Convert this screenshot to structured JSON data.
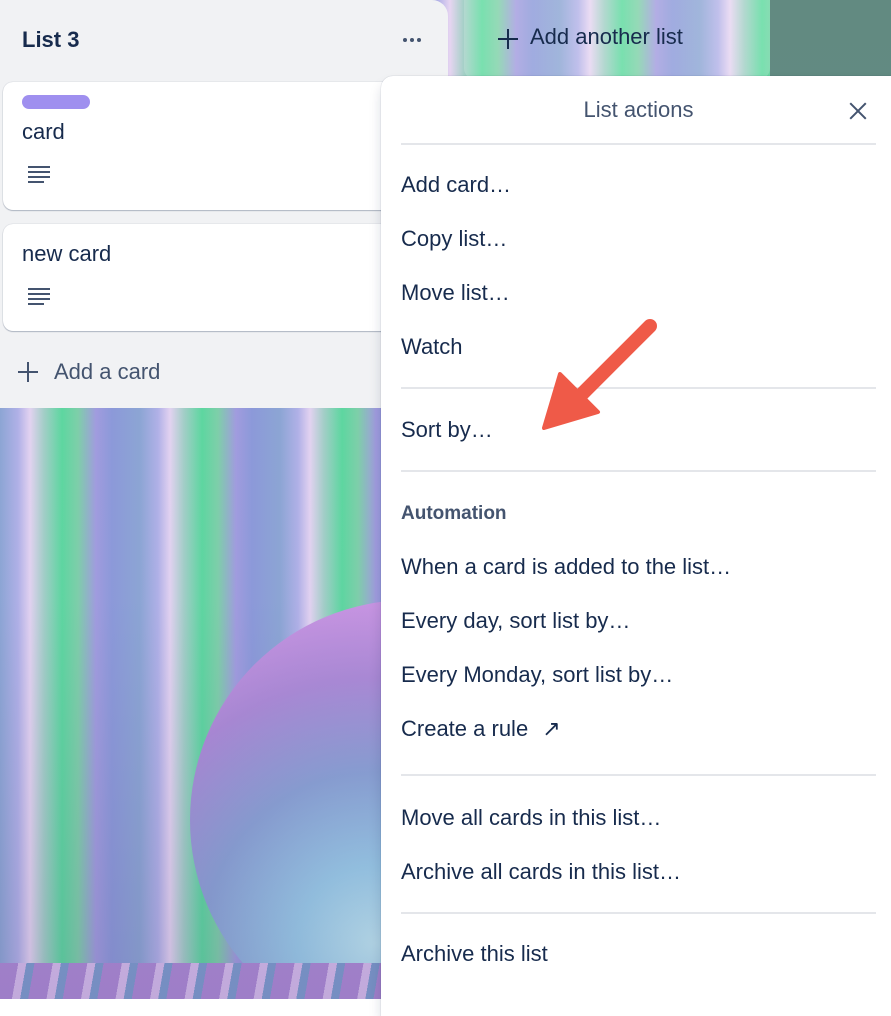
{
  "list": {
    "title": "List 3",
    "cards": [
      {
        "label_color": "#9f8fef",
        "title": "card",
        "has_description": true
      },
      {
        "title": "new card",
        "has_description": true
      }
    ],
    "add_card_label": "Add a card"
  },
  "add_list_label": "Add another list",
  "list_actions": {
    "title": "List actions",
    "group_1": [
      "Add card…",
      "Copy list…",
      "Move list…",
      "Watch"
    ],
    "group_2": [
      "Sort by…"
    ],
    "automation_heading": "Automation",
    "automation_items": [
      "When a card is added to the list…",
      "Every day, sort list by…",
      "Every Monday, sort list by…",
      "Create a rule"
    ],
    "create_rule_icon": "↗",
    "group_4": [
      "Move all cards in this list…",
      "Archive all cards in this list…"
    ],
    "group_5": [
      "Archive this list"
    ]
  },
  "annotation": {
    "color": "#ef5a48",
    "points_to": "Sort by…"
  }
}
